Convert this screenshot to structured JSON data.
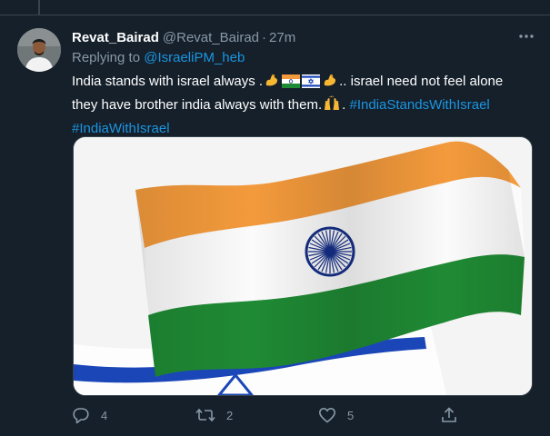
{
  "tweet": {
    "author_name": "Revat_Bairad",
    "author_handle": "@Revat_Bairad",
    "separator": "·",
    "time": "27m",
    "replying_to_label": "Replying to",
    "replying_to_handle": "@IsraeliPM_heb",
    "text_part1": "India stands with israel always .",
    "text_part2": ".. israel need not feel alone they have brother india always with them.",
    "text_part3": ".",
    "hashtag1": "#IndiaStandsWithIsrael",
    "hashtag2": "#IndiaWithIsrael",
    "emojis_group1": [
      "flexed-biceps",
      "india-flag",
      "israel-flag",
      "flexed-biceps"
    ],
    "emoji_group2": "raising-hands"
  },
  "media": {
    "description_icons": [
      "india-flag",
      "israel-flag"
    ],
    "colors": {
      "saffron": "#f39a3c",
      "white": "#fbfbfb",
      "green": "#1f8a34",
      "chakra": "#142b7c",
      "israel_blue": "#1a46b8"
    }
  },
  "actions": {
    "reply_count": "4",
    "retweet_count": "2",
    "like_count": "5"
  },
  "colors": {
    "background": "#15202b",
    "link": "#1b95e0",
    "secondary_text": "#8899a6",
    "primary_text": "#ffffff"
  }
}
